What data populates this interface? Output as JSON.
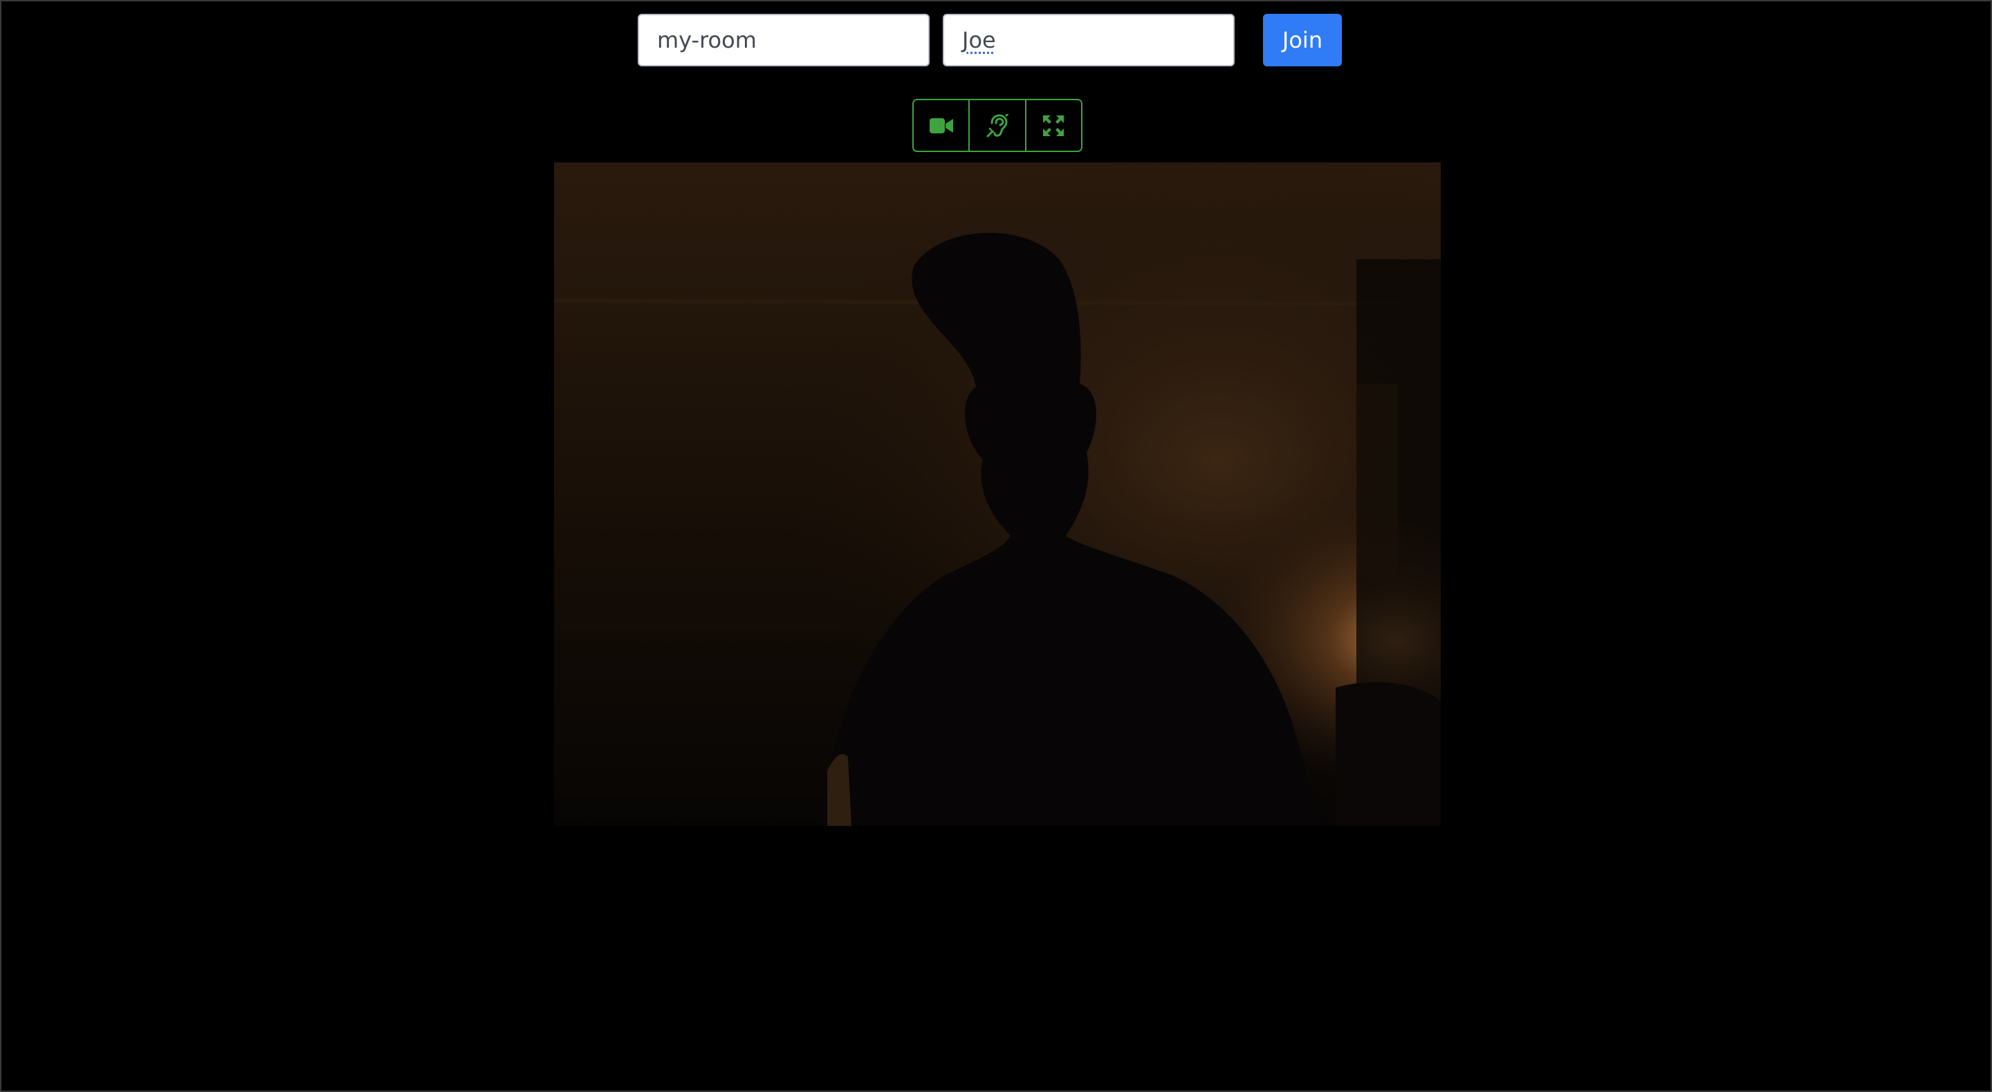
{
  "join_form": {
    "room_value": "my-room",
    "name_value": "Joe",
    "join_label": "Join"
  },
  "media_controls": {
    "icons": [
      "video-camera-icon",
      "assistive-listening-icon",
      "fullscreen-icon"
    ],
    "accent_color": "#3fa33f"
  },
  "colors": {
    "background": "#000000",
    "join_button": "#2f7cf6",
    "control_border": "#3fa33f"
  }
}
